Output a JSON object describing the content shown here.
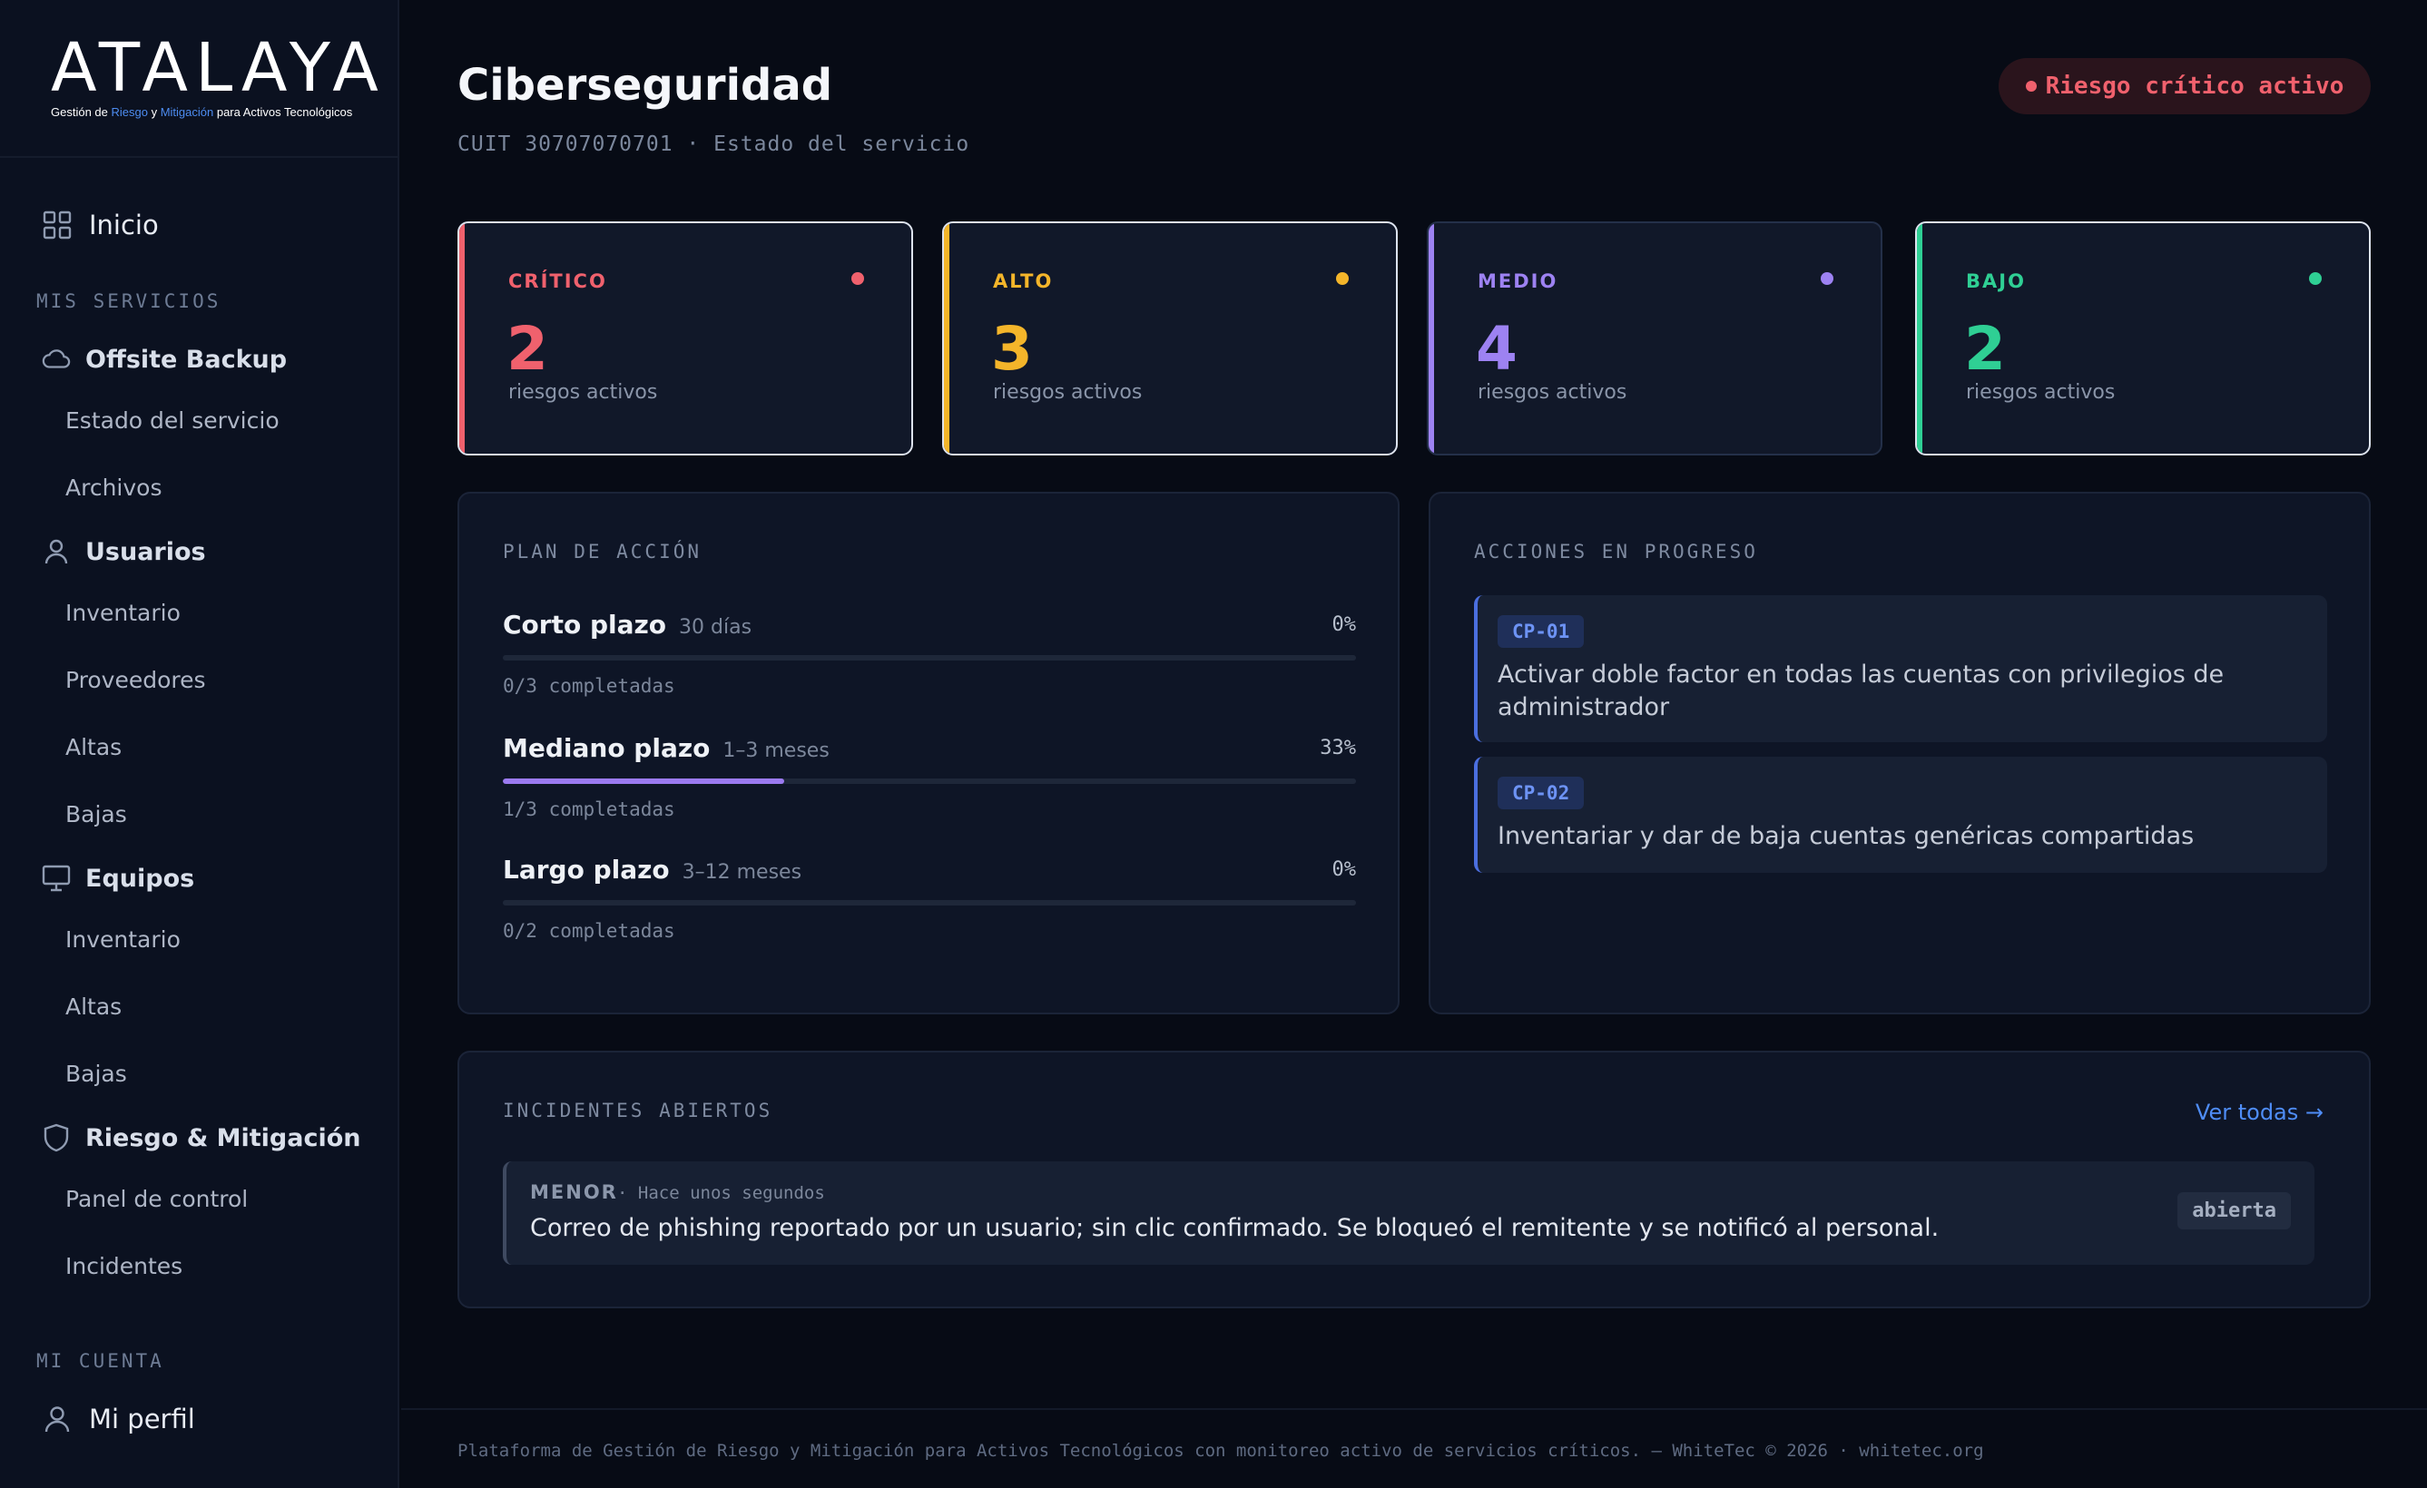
{
  "brand": {
    "name": "ATALAYA",
    "tagline_pre": "Gestión de ",
    "tagline_riesgo": "Riesgo",
    "tagline_mid": " y ",
    "tagline_mitigacion": "Mitigación",
    "tagline_post": " para Activos Tecnológicos"
  },
  "sidebar": {
    "home": "Inicio",
    "section_services": "MIS SERVICIOS",
    "groups": [
      {
        "title": "Offsite Backup",
        "icon": "cloud-icon",
        "items": [
          "Estado del servicio",
          "Archivos"
        ]
      },
      {
        "title": "Usuarios",
        "icon": "user-icon",
        "items": [
          "Inventario",
          "Proveedores",
          "Altas",
          "Bajas"
        ]
      },
      {
        "title": "Equipos",
        "icon": "monitor-icon",
        "items": [
          "Inventario",
          "Altas",
          "Bajas"
        ]
      },
      {
        "title": "Riesgo & Mitigación",
        "icon": "shield-icon",
        "items": [
          "Panel de control",
          "Incidentes"
        ]
      }
    ],
    "section_account": "MI CUENTA",
    "profile": "Mi perfil"
  },
  "header": {
    "title": "Ciberseguridad",
    "subtitle": "CUIT 30707070701 · Estado del servicio",
    "risk_badge": "Riesgo crítico activo"
  },
  "stats": [
    {
      "label": "CRÍTICO",
      "value": "2",
      "desc": "riesgos activos",
      "color": "#f0616d"
    },
    {
      "label": "ALTO",
      "value": "3",
      "desc": "riesgos activos",
      "color": "#f4b52a"
    },
    {
      "label": "MEDIO",
      "value": "4",
      "desc": "riesgos activos",
      "color": "#9d82f2"
    },
    {
      "label": "BAJO",
      "value": "2",
      "desc": "riesgos activos",
      "color": "#2fcf94"
    }
  ],
  "plan": {
    "label": "PLAN DE ACCIÓN",
    "rows": [
      {
        "name": "Corto plazo",
        "term": "30 días",
        "pct": "0%",
        "progress": 0,
        "count": "0/3 completadas"
      },
      {
        "name": "Mediano plazo",
        "term": "1–3 meses",
        "pct": "33%",
        "progress": 0.33,
        "count": "1/3 completadas"
      },
      {
        "name": "Largo plazo",
        "term": "3–12 meses",
        "pct": "0%",
        "progress": 0,
        "count": "0/2 completadas"
      }
    ]
  },
  "actions": {
    "label": "ACCIONES EN PROGRESO",
    "items": [
      {
        "code": "CP-01",
        "text": "Activar doble factor en todas las cuentas con privilegios de administrador"
      },
      {
        "code": "CP-02",
        "text": "Inventariar y dar de baja cuentas genéricas compartidas"
      }
    ]
  },
  "incidents": {
    "label": "INCIDENTES ABIERTOS",
    "view_all": "Ver todas →",
    "items": [
      {
        "severity": "MENOR",
        "time": "· Hace unos segundos",
        "text": "Correo de phishing reportado por un usuario; sin clic confirmado. Se bloqueó el remitente y se notificó al personal.",
        "status": "abierta"
      }
    ]
  },
  "footer": {
    "text": "Plataforma de Gestión de Riesgo y Mitigación para Activos Tecnológicos con monitoreo activo de servicios críticos. — WhiteTec © 2026 · whitetec.org"
  }
}
